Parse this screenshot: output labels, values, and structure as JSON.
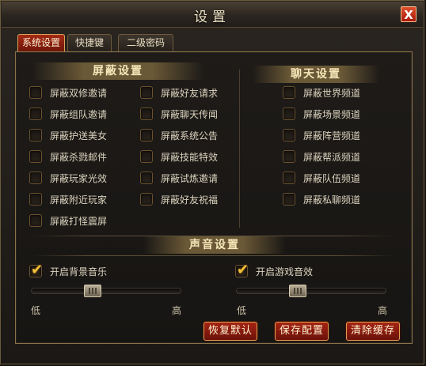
{
  "window": {
    "title": "设置",
    "close_label": "X"
  },
  "tabs": [
    {
      "label": "系统设置",
      "active": true
    },
    {
      "label": "快捷键",
      "active": false
    },
    {
      "label": "二级密码",
      "active": false
    }
  ],
  "block_settings": {
    "header": "屏蔽设置",
    "left_items": [
      "屏蔽双修邀请",
      "屏蔽组队邀请",
      "屏蔽护送美女",
      "屏蔽杀戮邮件",
      "屏蔽玩家光效",
      "屏蔽附近玩家",
      "屏蔽打怪震屏"
    ],
    "right_items": [
      "屏蔽好友请求",
      "屏蔽聊天传闻",
      "屏蔽系统公告",
      "屏蔽技能特效",
      "屏蔽试炼邀请",
      "屏蔽好友祝福"
    ]
  },
  "chat_settings": {
    "header": "聊天设置",
    "items": [
      "屏蔽世界频道",
      "屏蔽场景频道",
      "屏蔽阵营频道",
      "屏蔽帮派频道",
      "屏蔽队伍频道",
      "屏蔽私聊频道"
    ]
  },
  "sound_settings": {
    "header": "声音设置",
    "bg_music": {
      "label": "开启背景音乐",
      "checked": true,
      "volume": 0.4
    },
    "game_sfx": {
      "label": "开启游戏音效",
      "checked": true,
      "volume": 0.4
    },
    "low_label": "低",
    "high_label": "高"
  },
  "buttons": {
    "restore_default": "恢复默认",
    "save_config": "保存配置",
    "clear_cache": "清除缓存"
  },
  "colors": {
    "accent_red": "#a52412",
    "gold_border": "#e0a050",
    "checkmark": "#f2c23a"
  }
}
